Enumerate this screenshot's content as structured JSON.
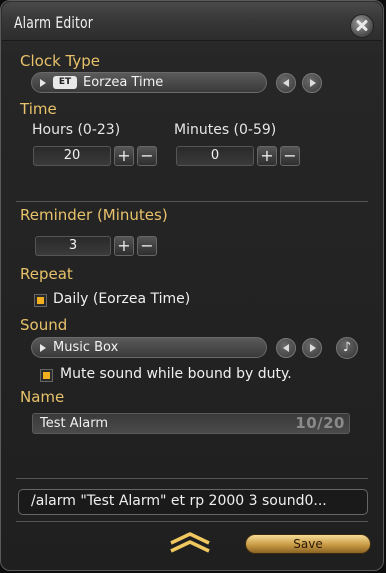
{
  "window": {
    "title": "Alarm Editor"
  },
  "clock": {
    "label": "Clock Type",
    "badge": "ET",
    "value": "Eorzea Time"
  },
  "time": {
    "label": "Time",
    "hours_label": "Hours (0-23)",
    "hours_value": "20",
    "minutes_label": "Minutes (0-59)",
    "minutes_value": "0"
  },
  "reminder": {
    "label": "Reminder (Minutes)",
    "value": "3"
  },
  "repeat": {
    "label": "Repeat",
    "option": "Daily (Eorzea Time)",
    "checked": true
  },
  "sound": {
    "label": "Sound",
    "value": "Music Box",
    "mute_text": "Mute sound while bound by duty.",
    "mute_checked": true
  },
  "name": {
    "label": "Name",
    "value": "Test Alarm",
    "count": "10/20"
  },
  "command": {
    "text": "/alarm \"Test Alarm\" et rp 2000 3 sound0..."
  },
  "buttons": {
    "save": "Save",
    "plus": "+",
    "minus": "−",
    "note": "♪"
  },
  "colors": {
    "label": "#e8c26a",
    "checkbox": "#f2b020",
    "save_button": "#d7ac58"
  },
  "icons": [
    "close-icon",
    "chevron-left-icon",
    "chevron-right-icon",
    "dropdown-arrow-icon",
    "music-note-icon",
    "collapse-chevrons-icon"
  ]
}
